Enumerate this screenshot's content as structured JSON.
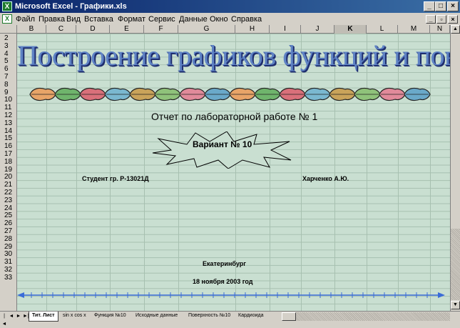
{
  "window": {
    "title": "Microsoft Excel - Графики.xls",
    "app_icon": "excel-icon",
    "controls": [
      "_",
      "□",
      "×"
    ]
  },
  "menu": {
    "items": [
      "Файл",
      "Правка",
      "Вид",
      "Вставка",
      "Формат",
      "Сервис",
      "Данные",
      "Окно",
      "Справка"
    ],
    "doc_controls": [
      "_",
      "▫",
      "×"
    ]
  },
  "columns": [
    "B",
    "C",
    "D",
    "E",
    "F",
    "G",
    "H",
    "I",
    "J",
    "K",
    "L",
    "M",
    "N"
  ],
  "selected_column": "K",
  "rows": [
    "2",
    "3",
    "4",
    "5",
    "6",
    "7",
    "8",
    "9",
    "10",
    "11",
    "12",
    "13",
    "14",
    "15",
    "16",
    "17",
    "18",
    "19",
    "20",
    "21",
    "22",
    "23",
    "24",
    "25",
    "26",
    "27",
    "28",
    "29",
    "30",
    "31",
    "32",
    "33"
  ],
  "sheet": {
    "big_title": "Построение графиков функций и поверхностей",
    "report_title": "Отчет по лабораторной работе № 1",
    "variant": "Вариант № 10",
    "student": "Студент гр. Р-13021Д",
    "author": "Харченко А.Ю.",
    "city": "Екатеринбург",
    "date": "18 ноября 2003 год"
  },
  "tabs": {
    "nav": [
      "|◄",
      "◄",
      "►",
      "►|"
    ],
    "items": [
      "Тит. Лист",
      "sin x cos x",
      "Функция №10",
      "Исходные данные",
      "Поверхность №10",
      "Кардиоида"
    ],
    "active_index": 0
  },
  "colors": {
    "title_blue": "#5e82c4",
    "grid_bg": "#c9dfd1",
    "axis_blue": "#3a6cd8",
    "titlebar": "#0a246a"
  }
}
